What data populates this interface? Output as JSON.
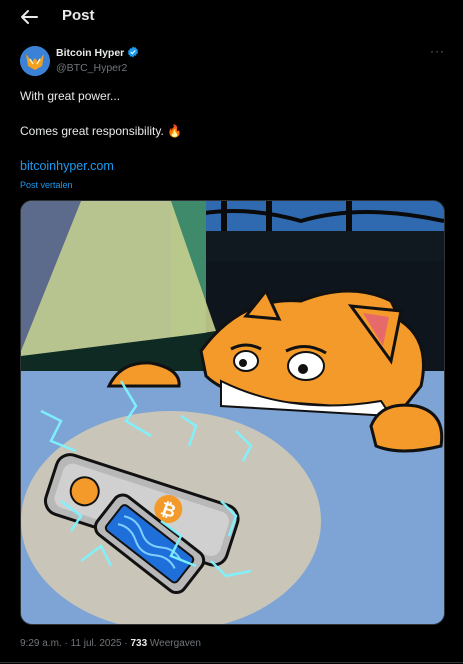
{
  "header": {
    "title": "Post",
    "back_icon": "arrow-left-icon"
  },
  "author": {
    "name": "Bitcoin Hyper",
    "handle": "@BTC_Hyper2",
    "verified_icon": "verified-badge-icon",
    "more_icon": "more-horizontal-icon"
  },
  "post": {
    "line1": "With great power...",
    "line2": "Comes great responsibility. 🔥",
    "link": "bitcoinhyper.com",
    "translate_label": "Post vertalen"
  },
  "meta": {
    "time": "9:29 a.m.",
    "date": "11 jul. 2025",
    "views_count": "733",
    "views_label": "Weergaven"
  },
  "colors": {
    "accent": "#1d9bf0",
    "bg": "#000000",
    "muted": "#71767b",
    "text": "#e7e9ea"
  }
}
